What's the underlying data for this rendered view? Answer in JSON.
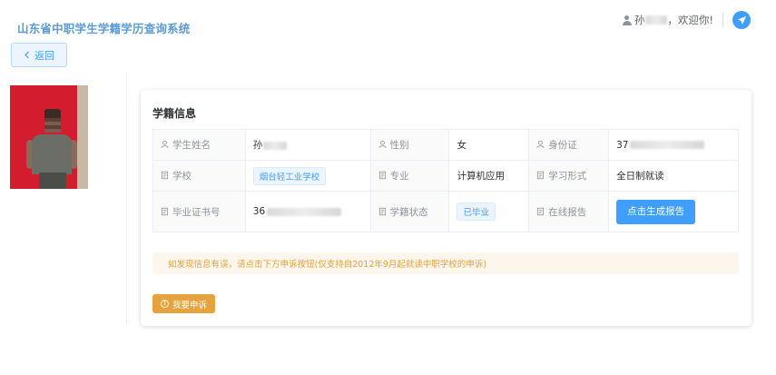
{
  "header": {
    "app_title": "山东省中职学生学籍学历查询系统",
    "user_name": "孙",
    "greeting": "，欢迎你!",
    "user_icon": "user-icon",
    "action_icon": "paper-plane-icon",
    "accent_color": "#409eff"
  },
  "nav": {
    "back_label": "返回",
    "back_icon": "chevron-left-icon"
  },
  "profile": {
    "photo_icon": "student-photo"
  },
  "record": {
    "title": "学籍信息",
    "rows": [
      [
        {
          "label": "学生姓名",
          "icon": "user-icon",
          "value": "孙"
        },
        {
          "label": "性别",
          "icon": "user-icon",
          "value": "女"
        },
        {
          "label": "身份证",
          "icon": "user-icon",
          "value": "37"
        }
      ],
      [
        {
          "label": "学校",
          "icon": "document-icon",
          "value": "烟台轻工业学校"
        },
        {
          "label": "专业",
          "icon": "document-icon",
          "value": "计算机应用"
        },
        {
          "label": "学习形式",
          "icon": "document-icon",
          "value": "全日制就读"
        }
      ],
      [
        {
          "label": "毕业证书号",
          "icon": "document-icon",
          "value": "36"
        },
        {
          "label": "学籍状态",
          "icon": "document-icon",
          "value": "已毕业"
        },
        {
          "label": "在线报告",
          "icon": "document-icon",
          "value": "点击生成报告"
        }
      ]
    ]
  },
  "notice": {
    "text": "如发现信息有误，请点击下方申诉按钮(仅支持自2012年9月起就读中职学校的申诉)",
    "color": "#e6a23c"
  },
  "appeal": {
    "label": "我要申诉",
    "icon": "warning-circle-icon"
  }
}
